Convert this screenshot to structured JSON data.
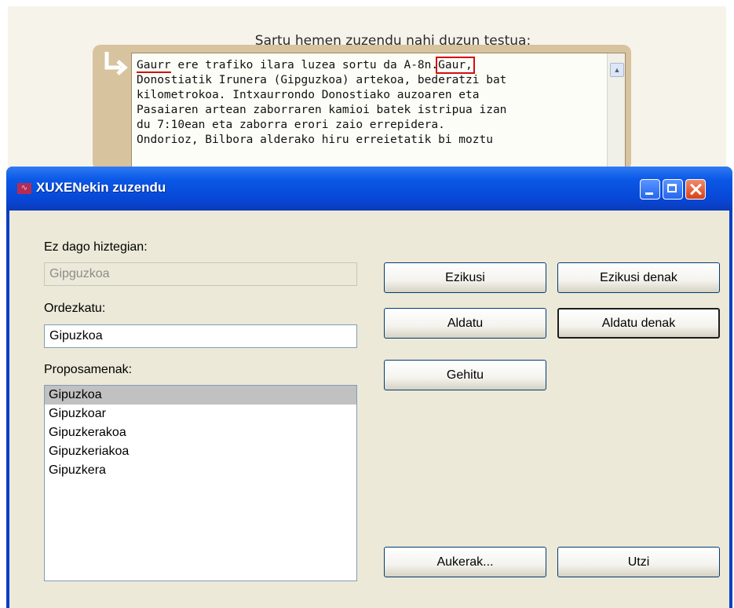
{
  "background_page": {
    "heading": "Sartu hemen zuzendu nahi duzun testua:",
    "editor": {
      "word_misspelled": "Gaurr",
      "segment_1": " ere trafiko ilara luzea sortu da A-8n.",
      "word_highlighted": "Gaur,",
      "segment_2": "\nDonostiatik Irunera (Gipguzkoa) artekoa, bederatzi bat\nkilometrokoa. Intxaurrondo Donostiako auzoaren eta\nPasaiaren artean zaborraren kamioi batek istripua izan\ndu 7:10ean eta zaborra erori zaio errepidera.\nOndorioz, Bilbora alderako hiru erreietatik bi moztu",
      "error_color": "#d01010"
    }
  },
  "dialog": {
    "title": "XUXENekin zuzendu",
    "not_in_dictionary_label": "Ez dago hiztegian:",
    "not_in_dictionary_value": "Gipguzkoa",
    "replace_label": "Ordezkatu:",
    "replace_value": "Gipuzkoa",
    "suggestions_label": "Proposamenak:",
    "suggestions": [
      "Gipuzkoa",
      "Gipuzkoar",
      "Gipuzkerakoa",
      "Gipuzkeriakoa",
      "Gipuzkera"
    ],
    "selected_suggestion": "Gipuzkoa",
    "buttons": {
      "ignore": "Ezikusi",
      "ignore_all": "Ezikusi denak",
      "change": "Aldatu",
      "change_all": "Aldatu denak",
      "add": "Gehitu",
      "options": "Aukerak...",
      "cancel": "Utzi"
    },
    "colors": {
      "titlebar": "#0a58e6",
      "client": "#ece9d8",
      "close_button": "#d9401a"
    }
  }
}
